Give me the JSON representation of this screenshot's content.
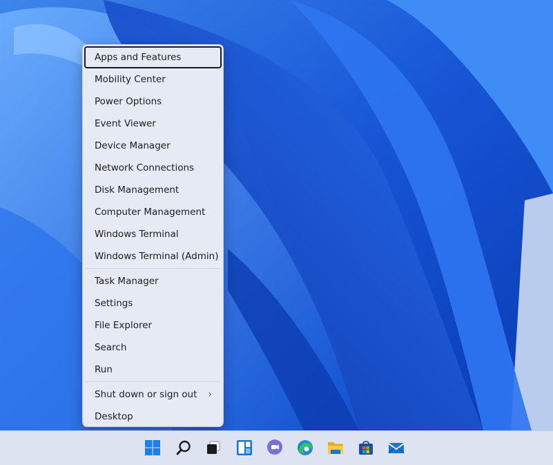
{
  "colors": {
    "accent": "#0f5bd6",
    "menu_bg": "#e6eaf5",
    "taskbar_bg": "#dde3f1"
  },
  "menu": {
    "group1": [
      {
        "label": "Apps and Features",
        "focused": true
      },
      {
        "label": "Mobility Center"
      },
      {
        "label": "Power Options"
      },
      {
        "label": "Event Viewer"
      },
      {
        "label": "Device Manager"
      },
      {
        "label": "Network Connections"
      },
      {
        "label": "Disk Management"
      },
      {
        "label": "Computer Management"
      },
      {
        "label": "Windows Terminal"
      },
      {
        "label": "Windows Terminal (Admin)"
      }
    ],
    "group2": [
      {
        "label": "Task Manager"
      },
      {
        "label": "Settings"
      },
      {
        "label": "File Explorer"
      },
      {
        "label": "Search"
      },
      {
        "label": "Run"
      }
    ],
    "group3": [
      {
        "label": "Shut down or sign out",
        "submenu_icon": "chevron-right-icon"
      },
      {
        "label": "Desktop"
      }
    ]
  },
  "taskbar": {
    "icons": [
      "windows-start-icon",
      "search-icon",
      "task-view-icon",
      "widgets-icon",
      "teams-chat-icon",
      "edge-icon",
      "file-explorer-icon",
      "store-icon",
      "mail-icon"
    ]
  }
}
